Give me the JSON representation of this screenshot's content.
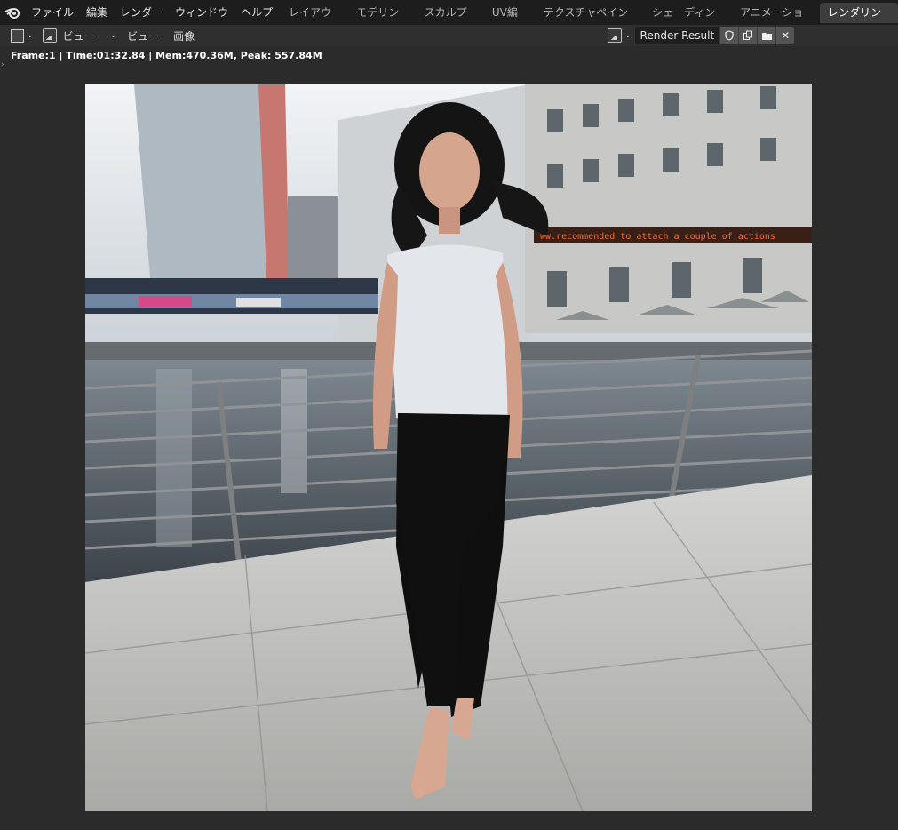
{
  "topbar": {
    "menu": [
      "ファイル",
      "編集",
      "レンダー",
      "ウィンドウ",
      "ヘルプ"
    ]
  },
  "workspaces": {
    "tabs": [
      "レイアウト",
      "モデリング",
      "スカルプト",
      "UV編集",
      "テクスチャペイント",
      "シェーディング",
      "アニメーション",
      "レンダリング"
    ],
    "active": "レンダリング"
  },
  "header": {
    "view_menu": "ビュー",
    "view_label": "ビュー",
    "image_label": "画像",
    "render_result": "Render Result"
  },
  "status": {
    "text": "Frame:1 | Time:01:32.84 | Mem:470.36M, Peak: 557.84M"
  },
  "scene": {
    "sign_text": "ww.recommended to attach a couple of actions"
  },
  "colors": {
    "accent_bg": "#1d1d1d",
    "active_tab": "#3d3d3d"
  }
}
